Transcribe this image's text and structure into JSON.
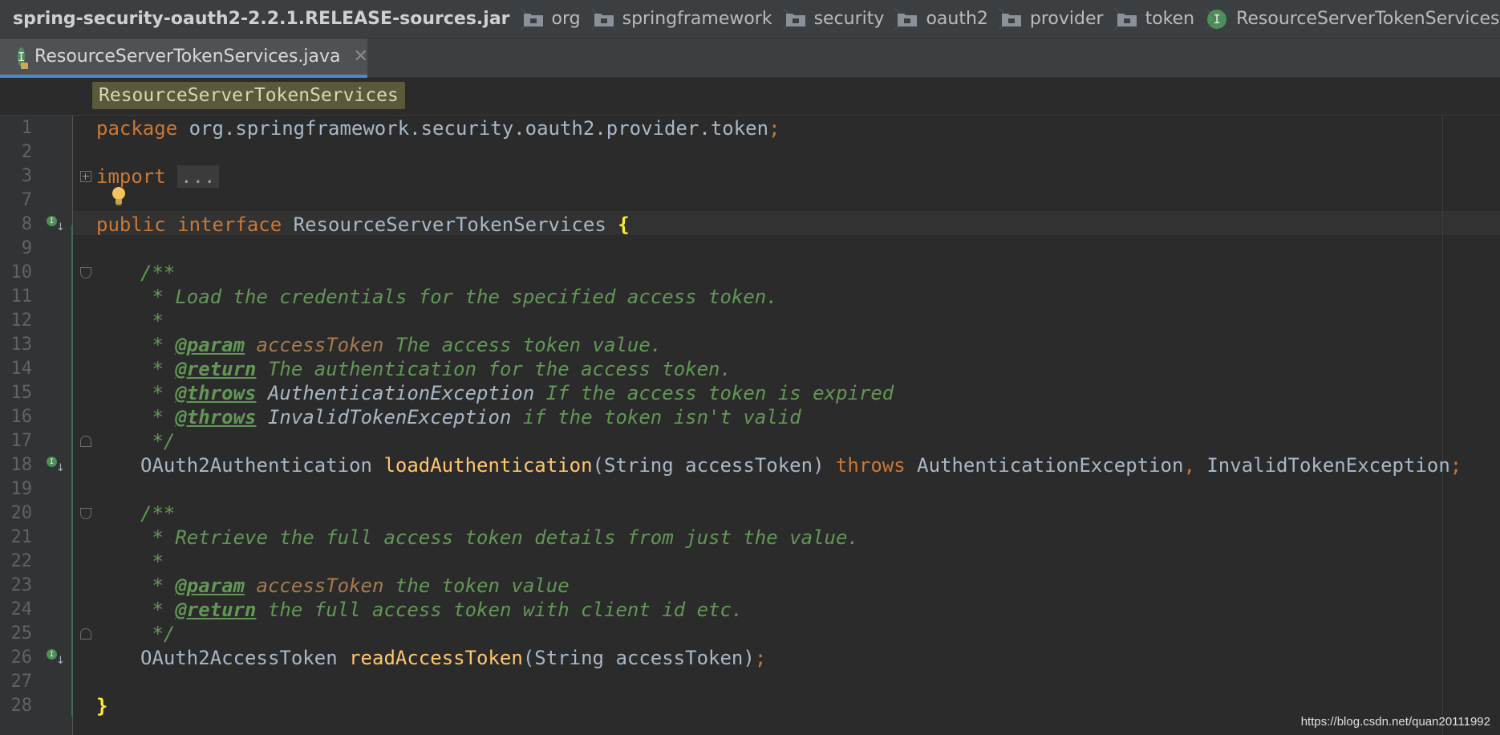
{
  "breadcrumb": {
    "jar": "spring-security-oauth2-2.2.1.RELEASE-sources.jar",
    "packages": [
      "org",
      "springframework",
      "security",
      "oauth2",
      "provider",
      "token"
    ],
    "class": "ResourceServerTokenServices",
    "class_icon": "I"
  },
  "tab": {
    "label": "ResourceServerTokenServices.java",
    "icon": "I",
    "close": "✕"
  },
  "structure": {
    "label": "ResourceServerTokenServices"
  },
  "colors": {
    "keyword": "#cc7832",
    "doc": "#629755",
    "function": "#ffc66d",
    "text": "#a9b7c6",
    "param": "#a57b4e",
    "background": "#2b2b2b"
  },
  "code": {
    "numbers": [
      "1",
      "2",
      "3",
      "7",
      "8",
      "9",
      "10",
      "11",
      "12",
      "13",
      "14",
      "15",
      "16",
      "17",
      "18",
      "19",
      "20",
      "21",
      "22",
      "23",
      "24",
      "25",
      "26",
      "27",
      "28"
    ],
    "l1_kw": "package",
    "l1_rest": " org.springframework.security.oauth2.provider.token",
    "l1_semi": ";",
    "l3_kw": "import",
    "l3_fold": "...",
    "l8_kw1": "public",
    "l8_kw2": "interface",
    "l8_name": "ResourceServerTokenServices",
    "l8_brace": "{",
    "l10": "/**",
    "l11": " * Load the credentials for the specified access token.",
    "l12": " *",
    "l13_star": " * ",
    "l13_tag": "@param",
    "l13_pname": "accessToken",
    "l13_text": " The access token value.",
    "l14_star": " * ",
    "l14_tag": "@return",
    "l14_text": " The authentication for the access token.",
    "l15_star": " * ",
    "l15_tag": "@throws",
    "l15_exc": "AuthenticationException",
    "l15_text": " If the access token is expired",
    "l16_star": " * ",
    "l16_tag": "@throws",
    "l16_exc": "InvalidTokenException",
    "l16_text": " if the token isn't valid",
    "l17": " */",
    "l18_type": "OAuth2Authentication ",
    "l18_fn": "loadAuthentication",
    "l18_params": "(String accessToken) ",
    "l18_kw": "throws",
    "l18_exc1": " AuthenticationException",
    "l18_comma": ",",
    "l18_exc2": " InvalidTokenException",
    "l18_semi": ";",
    "l20": "/**",
    "l21": " * Retrieve the full access token details from just the value.",
    "l22": " *",
    "l23_star": " * ",
    "l23_tag": "@param",
    "l23_pname": "accessToken",
    "l23_text": " the token value",
    "l24_star": " * ",
    "l24_tag": "@return",
    "l24_text": " the full access token with client id etc.",
    "l25": " */",
    "l26_type": "OAuth2AccessToken ",
    "l26_fn": "readAccessToken",
    "l26_params": "(String accessToken)",
    "l26_semi": ";",
    "l28_brace": "}"
  },
  "gutter_icons": [
    "implemented-icon",
    "implemented-icon",
    "implemented-icon"
  ],
  "watermark": "https://blog.csdn.net/quan20111992"
}
